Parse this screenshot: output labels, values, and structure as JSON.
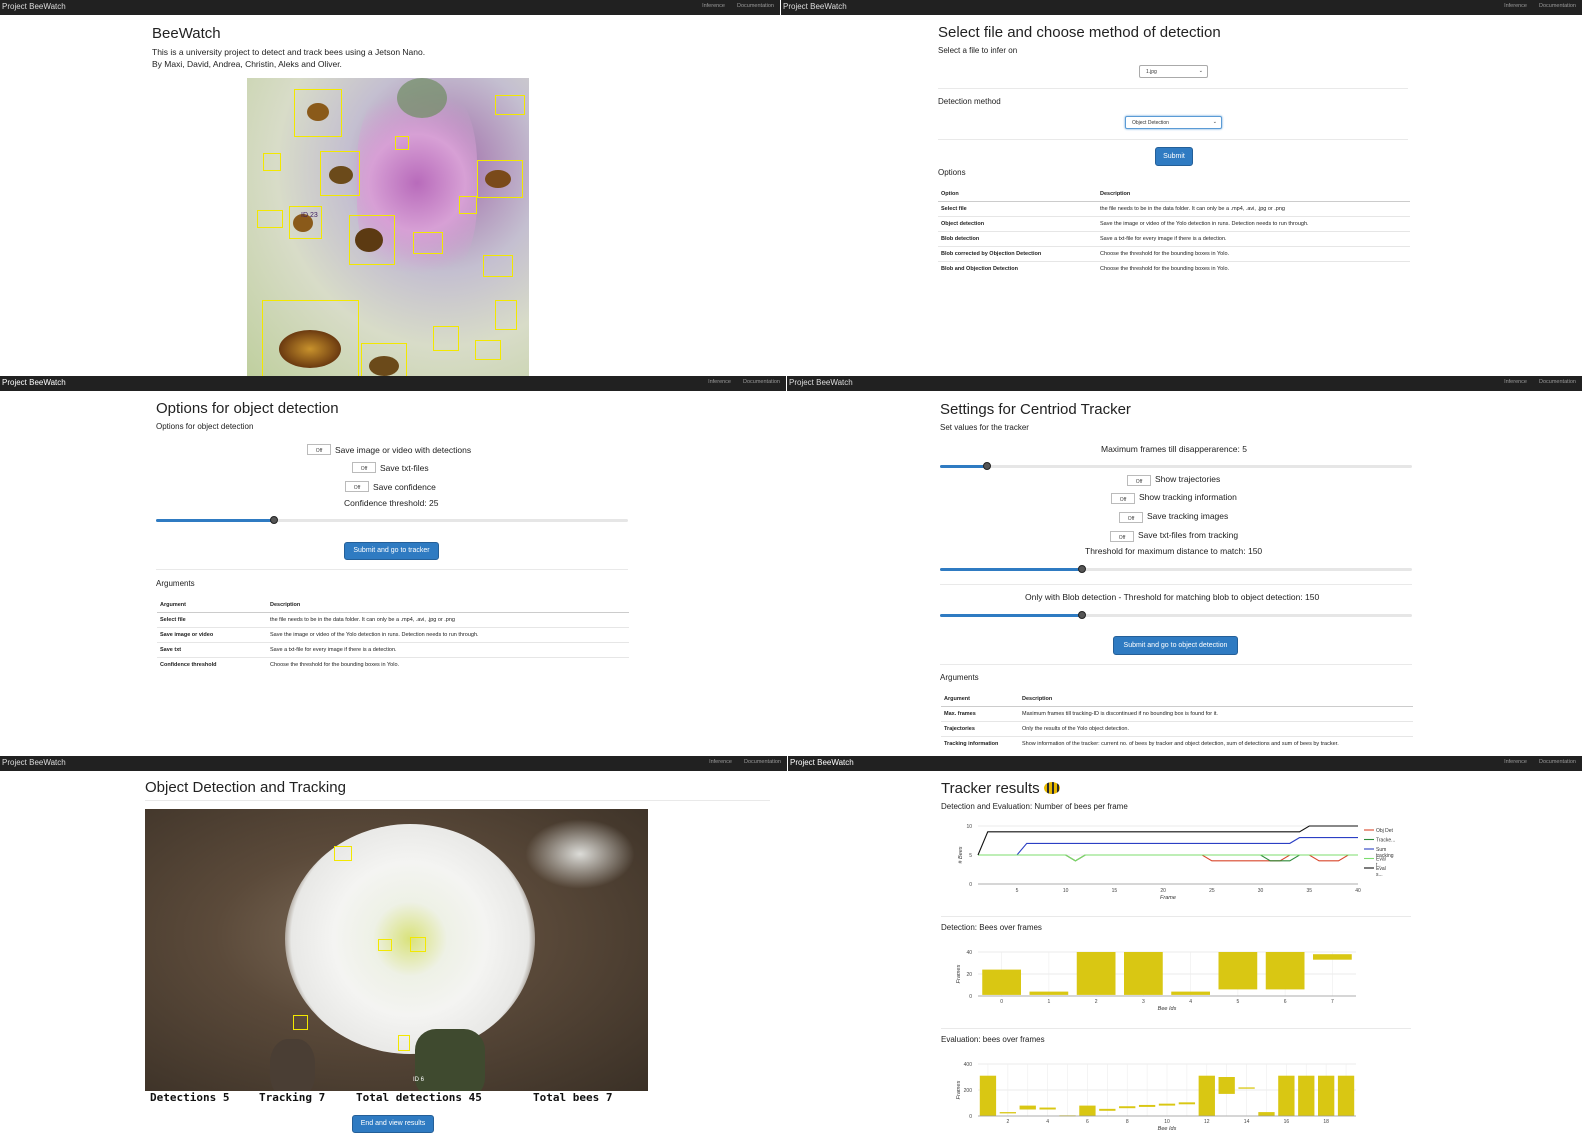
{
  "nav": {
    "brand": "Project BeeWatch",
    "inference": "Inference",
    "documentation": "Documentation"
  },
  "home": {
    "title": "BeeWatch",
    "intro_line1": "This is a university project to detect and track bees using a Jetson Nano.",
    "intro_line2": "By Maxi, David, Andrea, Christin, Aleks and Oliver.",
    "bee_labels": [
      "ID 23"
    ]
  },
  "select": {
    "title": "Select file and choose method of detection",
    "file_prompt": "Select a file to infer on",
    "file_value": "1.jpg",
    "method_label": "Detection method",
    "method_value": "Object Detection",
    "submit": "Submit",
    "options_heading": "Options",
    "table": {
      "headers": [
        "Option",
        "Description"
      ],
      "rows": [
        [
          "Select file",
          "the file needs to be in the data folder. It can only be a .mp4, .avi, .jpg or .png"
        ],
        [
          "Object detection",
          "Save the image or video of the Yolo detection in runs. Detection needs to run through."
        ],
        [
          "Blob detection",
          "Save a txt-file for every image if there is a detection."
        ],
        [
          "Blob corrected by Objection Detection",
          "Choose the threshold for the bounding boxes in Yolo."
        ],
        [
          "Blob and Objection Detection",
          "Choose the threshold for the bounding boxes in Yolo."
        ]
      ]
    }
  },
  "objopts": {
    "title": "Options for object detection",
    "subtitle": "Options for object detection",
    "toggle_off": "Off",
    "toggles": [
      "Save image or video with detections",
      "Save txt-files",
      "Save confidence"
    ],
    "threshold_label": "Confidence threshold: 25",
    "threshold_value": 25,
    "threshold_max": 100,
    "submit": "Submit and go to tracker",
    "arguments_heading": "Arguments",
    "table": {
      "headers": [
        "Argument",
        "Description"
      ],
      "rows": [
        [
          "Select file",
          "the file needs to be in the data folder. It can only be a .mp4, .avi, .jpg or .png"
        ],
        [
          "Save image or video",
          "Save the image or video of the Yolo detection in runs. Detection needs to run through."
        ],
        [
          "Save txt",
          "Save a txt-file for every image if there is a detection."
        ],
        [
          "Confidence threshold",
          "Choose the threshold for the bounding boxes in Yolo."
        ]
      ]
    }
  },
  "tracker": {
    "title": "Settings for Centriod Tracker",
    "subtitle": "Set values for the tracker",
    "max_frames_label": "Maximum frames till disapperarence: 5",
    "max_frames_value": 5,
    "max_frames_max": 50,
    "toggle_off": "Off",
    "toggles": [
      "Show trajectories",
      "Show tracking information",
      "Save tracking images",
      "Save txt-files from tracking"
    ],
    "distance_label": "Threshold for maximum distance to match: 150",
    "distance_value": 150,
    "distance_max": 500,
    "blob_label": "Only with Blob detection - Threshold for matching blob to object detection: 150",
    "blob_value": 150,
    "blob_max": 500,
    "submit": "Submit and go to object detection",
    "arguments_heading": "Arguments",
    "table": {
      "headers": [
        "Argument",
        "Description"
      ],
      "rows": [
        [
          "Max. frames",
          "Maximum frames till tracking-ID is discontinued if no bounding box is found for it."
        ],
        [
          "Trajectories",
          "Only the results of the Yolo object detection."
        ],
        [
          "Tracking information",
          "Show information of the tracker: current no. of bees by tracker and object detection, sum of detections and sum of bees by tracker."
        ]
      ]
    }
  },
  "detect": {
    "title": "Object Detection and Tracking",
    "stats": [
      "Detections 5",
      "Tracking 7",
      "Total detections 45",
      "Total bees 7"
    ],
    "button": "End and view results",
    "box_labels": [
      "ID 6"
    ]
  },
  "results": {
    "title": "Tracker results",
    "title_icon": "bee-emoji-icon",
    "chart1_title": "Detection and Evaluation: Number of bees per frame",
    "chart2_title": "Detection: Bees over frames",
    "chart3_title": "Evaluation: bees over frames"
  },
  "colors": {
    "navbar": "#212121",
    "primary": "#2f7bc2",
    "bar": "#d9c713",
    "bbox": "#f2e800"
  },
  "chart_data": [
    {
      "type": "line",
      "title": "",
      "xlabel": "Frame",
      "ylabel": "# Bees",
      "xlim": [
        1,
        40
      ],
      "ylim": [
        0,
        10
      ],
      "x_ticks": [
        5,
        10,
        15,
        20,
        25,
        30,
        35,
        40
      ],
      "y_ticks": [
        0,
        5,
        10
      ],
      "legend_position": "right",
      "series": [
        {
          "name": "Obj Det",
          "color": "#d9472b",
          "points": [
            [
              1,
              5
            ],
            [
              10,
              5
            ],
            [
              11,
              4
            ],
            [
              12,
              5
            ],
            [
              24,
              5
            ],
            [
              25,
              4
            ],
            [
              32,
              4
            ],
            [
              33,
              5
            ],
            [
              35,
              5
            ],
            [
              36,
              4
            ],
            [
              38,
              4
            ],
            [
              39,
              5
            ],
            [
              40,
              5
            ]
          ]
        },
        {
          "name": "Tracke...",
          "color": "#2e8b3a",
          "points": [
            [
              1,
              5
            ],
            [
              10,
              5
            ],
            [
              11,
              4
            ],
            [
              12,
              5
            ],
            [
              24,
              5
            ],
            [
              25,
              5
            ],
            [
              30,
              5
            ],
            [
              31,
              4
            ],
            [
              33,
              4
            ],
            [
              34,
              5
            ],
            [
              40,
              5
            ]
          ]
        },
        {
          "name": "Sum tracking",
          "color": "#2b3fc4",
          "points": [
            [
              1,
              5
            ],
            [
              5,
              5
            ],
            [
              6,
              7
            ],
            [
              33,
              7
            ],
            [
              34,
              8
            ],
            [
              40,
              8
            ]
          ]
        },
        {
          "name": "Eval t...",
          "color": "#7cdd6e",
          "points": [
            [
              1,
              5
            ],
            [
              10,
              5
            ],
            [
              11,
              4
            ],
            [
              12,
              5
            ],
            [
              40,
              5
            ]
          ]
        },
        {
          "name": "Eval s...",
          "color": "#111111",
          "points": [
            [
              1,
              5
            ],
            [
              2,
              9
            ],
            [
              34,
              9
            ],
            [
              35,
              10
            ],
            [
              40,
              10
            ]
          ]
        }
      ]
    },
    {
      "type": "bar",
      "title": "",
      "xlabel": "Bee Ids",
      "ylabel": "Frames",
      "ylim": [
        0,
        40
      ],
      "y_ticks": [
        0,
        20,
        40
      ],
      "categories": [
        "0",
        "1",
        "2",
        "3",
        "4",
        "5",
        "6",
        "7"
      ],
      "ranges": [
        [
          1,
          24
        ],
        [
          1,
          4
        ],
        [
          1,
          40
        ],
        [
          1,
          40
        ],
        [
          1,
          4
        ],
        [
          6,
          40
        ],
        [
          6,
          40
        ],
        [
          33,
          38
        ]
      ]
    },
    {
      "type": "bar",
      "title": "",
      "xlabel": "Bee Ids",
      "ylabel": "Frames",
      "ylim": [
        0,
        400
      ],
      "y_ticks": [
        0,
        200,
        400
      ],
      "x_ticks": [
        "2",
        "4",
        "6",
        "8",
        "10",
        "12",
        "14",
        "16",
        "18"
      ],
      "categories": [
        "1",
        "2",
        "3",
        "4",
        "5",
        "6",
        "7",
        "8",
        "9",
        "10",
        "11",
        "12",
        "13",
        "14",
        "15",
        "16",
        "17",
        "18",
        "19"
      ],
      "ranges": [
        [
          0,
          310
        ],
        [
          20,
          30
        ],
        [
          50,
          80
        ],
        [
          50,
          65
        ],
        [
          0,
          5
        ],
        [
          0,
          80
        ],
        [
          40,
          55
        ],
        [
          60,
          75
        ],
        [
          70,
          85
        ],
        [
          80,
          95
        ],
        [
          90,
          105
        ],
        [
          0,
          310
        ],
        [
          170,
          300
        ],
        [
          210,
          220
        ],
        [
          0,
          30
        ],
        [
          0,
          310
        ],
        [
          0,
          310
        ],
        [
          0,
          310
        ],
        [
          0,
          310
        ]
      ]
    }
  ]
}
